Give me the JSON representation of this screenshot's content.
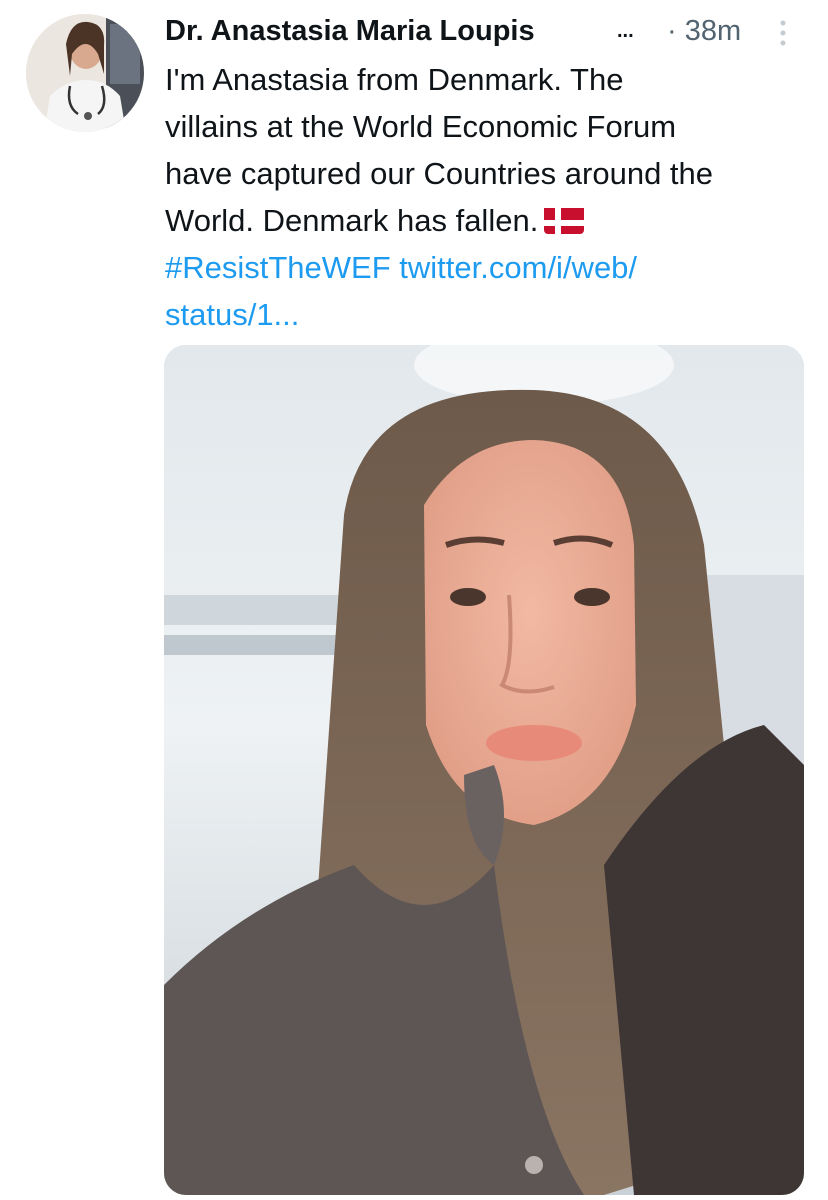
{
  "tweet": {
    "author_name": "Dr. Anastasia Maria Loupis",
    "name_overflow": "...",
    "timestamp": "· 38m",
    "text_lines": [
      "I'm Anastasia from Denmark. The",
      "villains at the World Economic Forum",
      "have captured our Countries around the",
      "World. Denmark has fallen."
    ],
    "hashtag": "#ResistTheWEF",
    "link_part1": "twitter.com/i/web/",
    "link_part2": "status/1...",
    "flag_icon": "denmark-flag-emoji",
    "more_icon": "vertical-ellipsis-icon",
    "media_description_icon": "selfie-photo"
  },
  "colors": {
    "text": "#0f1419",
    "secondary": "#536471",
    "link": "#1d9bf0",
    "flag_red": "#c8102e"
  }
}
